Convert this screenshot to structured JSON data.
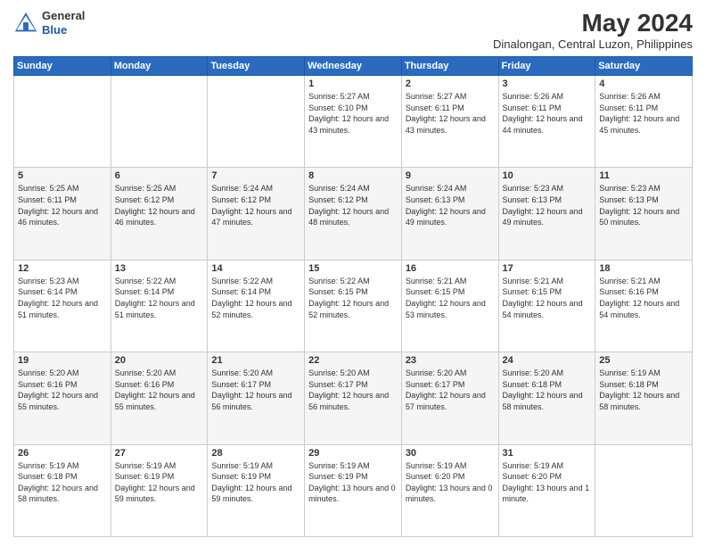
{
  "header": {
    "logo_general": "General",
    "logo_blue": "Blue",
    "month": "May 2024",
    "location": "Dinalongan, Central Luzon, Philippines"
  },
  "weekdays": [
    "Sunday",
    "Monday",
    "Tuesday",
    "Wednesday",
    "Thursday",
    "Friday",
    "Saturday"
  ],
  "weeks": [
    [
      {
        "day": "",
        "sunrise": "",
        "sunset": "",
        "daylight": ""
      },
      {
        "day": "",
        "sunrise": "",
        "sunset": "",
        "daylight": ""
      },
      {
        "day": "",
        "sunrise": "",
        "sunset": "",
        "daylight": ""
      },
      {
        "day": "1",
        "sunrise": "Sunrise: 5:27 AM",
        "sunset": "Sunset: 6:10 PM",
        "daylight": "Daylight: 12 hours and 43 minutes."
      },
      {
        "day": "2",
        "sunrise": "Sunrise: 5:27 AM",
        "sunset": "Sunset: 6:11 PM",
        "daylight": "Daylight: 12 hours and 43 minutes."
      },
      {
        "day": "3",
        "sunrise": "Sunrise: 5:26 AM",
        "sunset": "Sunset: 6:11 PM",
        "daylight": "Daylight: 12 hours and 44 minutes."
      },
      {
        "day": "4",
        "sunrise": "Sunrise: 5:26 AM",
        "sunset": "Sunset: 6:11 PM",
        "daylight": "Daylight: 12 hours and 45 minutes."
      }
    ],
    [
      {
        "day": "5",
        "sunrise": "Sunrise: 5:25 AM",
        "sunset": "Sunset: 6:11 PM",
        "daylight": "Daylight: 12 hours and 46 minutes."
      },
      {
        "day": "6",
        "sunrise": "Sunrise: 5:25 AM",
        "sunset": "Sunset: 6:12 PM",
        "daylight": "Daylight: 12 hours and 46 minutes."
      },
      {
        "day": "7",
        "sunrise": "Sunrise: 5:24 AM",
        "sunset": "Sunset: 6:12 PM",
        "daylight": "Daylight: 12 hours and 47 minutes."
      },
      {
        "day": "8",
        "sunrise": "Sunrise: 5:24 AM",
        "sunset": "Sunset: 6:12 PM",
        "daylight": "Daylight: 12 hours and 48 minutes."
      },
      {
        "day": "9",
        "sunrise": "Sunrise: 5:24 AM",
        "sunset": "Sunset: 6:13 PM",
        "daylight": "Daylight: 12 hours and 49 minutes."
      },
      {
        "day": "10",
        "sunrise": "Sunrise: 5:23 AM",
        "sunset": "Sunset: 6:13 PM",
        "daylight": "Daylight: 12 hours and 49 minutes."
      },
      {
        "day": "11",
        "sunrise": "Sunrise: 5:23 AM",
        "sunset": "Sunset: 6:13 PM",
        "daylight": "Daylight: 12 hours and 50 minutes."
      }
    ],
    [
      {
        "day": "12",
        "sunrise": "Sunrise: 5:23 AM",
        "sunset": "Sunset: 6:14 PM",
        "daylight": "Daylight: 12 hours and 51 minutes."
      },
      {
        "day": "13",
        "sunrise": "Sunrise: 5:22 AM",
        "sunset": "Sunset: 6:14 PM",
        "daylight": "Daylight: 12 hours and 51 minutes."
      },
      {
        "day": "14",
        "sunrise": "Sunrise: 5:22 AM",
        "sunset": "Sunset: 6:14 PM",
        "daylight": "Daylight: 12 hours and 52 minutes."
      },
      {
        "day": "15",
        "sunrise": "Sunrise: 5:22 AM",
        "sunset": "Sunset: 6:15 PM",
        "daylight": "Daylight: 12 hours and 52 minutes."
      },
      {
        "day": "16",
        "sunrise": "Sunrise: 5:21 AM",
        "sunset": "Sunset: 6:15 PM",
        "daylight": "Daylight: 12 hours and 53 minutes."
      },
      {
        "day": "17",
        "sunrise": "Sunrise: 5:21 AM",
        "sunset": "Sunset: 6:15 PM",
        "daylight": "Daylight: 12 hours and 54 minutes."
      },
      {
        "day": "18",
        "sunrise": "Sunrise: 5:21 AM",
        "sunset": "Sunset: 6:16 PM",
        "daylight": "Daylight: 12 hours and 54 minutes."
      }
    ],
    [
      {
        "day": "19",
        "sunrise": "Sunrise: 5:20 AM",
        "sunset": "Sunset: 6:16 PM",
        "daylight": "Daylight: 12 hours and 55 minutes."
      },
      {
        "day": "20",
        "sunrise": "Sunrise: 5:20 AM",
        "sunset": "Sunset: 6:16 PM",
        "daylight": "Daylight: 12 hours and 55 minutes."
      },
      {
        "day": "21",
        "sunrise": "Sunrise: 5:20 AM",
        "sunset": "Sunset: 6:17 PM",
        "daylight": "Daylight: 12 hours and 56 minutes."
      },
      {
        "day": "22",
        "sunrise": "Sunrise: 5:20 AM",
        "sunset": "Sunset: 6:17 PM",
        "daylight": "Daylight: 12 hours and 56 minutes."
      },
      {
        "day": "23",
        "sunrise": "Sunrise: 5:20 AM",
        "sunset": "Sunset: 6:17 PM",
        "daylight": "Daylight: 12 hours and 57 minutes."
      },
      {
        "day": "24",
        "sunrise": "Sunrise: 5:20 AM",
        "sunset": "Sunset: 6:18 PM",
        "daylight": "Daylight: 12 hours and 58 minutes."
      },
      {
        "day": "25",
        "sunrise": "Sunrise: 5:19 AM",
        "sunset": "Sunset: 6:18 PM",
        "daylight": "Daylight: 12 hours and 58 minutes."
      }
    ],
    [
      {
        "day": "26",
        "sunrise": "Sunrise: 5:19 AM",
        "sunset": "Sunset: 6:18 PM",
        "daylight": "Daylight: 12 hours and 58 minutes."
      },
      {
        "day": "27",
        "sunrise": "Sunrise: 5:19 AM",
        "sunset": "Sunset: 6:19 PM",
        "daylight": "Daylight: 12 hours and 59 minutes."
      },
      {
        "day": "28",
        "sunrise": "Sunrise: 5:19 AM",
        "sunset": "Sunset: 6:19 PM",
        "daylight": "Daylight: 12 hours and 59 minutes."
      },
      {
        "day": "29",
        "sunrise": "Sunrise: 5:19 AM",
        "sunset": "Sunset: 6:19 PM",
        "daylight": "Daylight: 13 hours and 0 minutes."
      },
      {
        "day": "30",
        "sunrise": "Sunrise: 5:19 AM",
        "sunset": "Sunset: 6:20 PM",
        "daylight": "Daylight: 13 hours and 0 minutes."
      },
      {
        "day": "31",
        "sunrise": "Sunrise: 5:19 AM",
        "sunset": "Sunset: 6:20 PM",
        "daylight": "Daylight: 13 hours and 1 minute."
      },
      {
        "day": "",
        "sunrise": "",
        "sunset": "",
        "daylight": ""
      }
    ]
  ]
}
